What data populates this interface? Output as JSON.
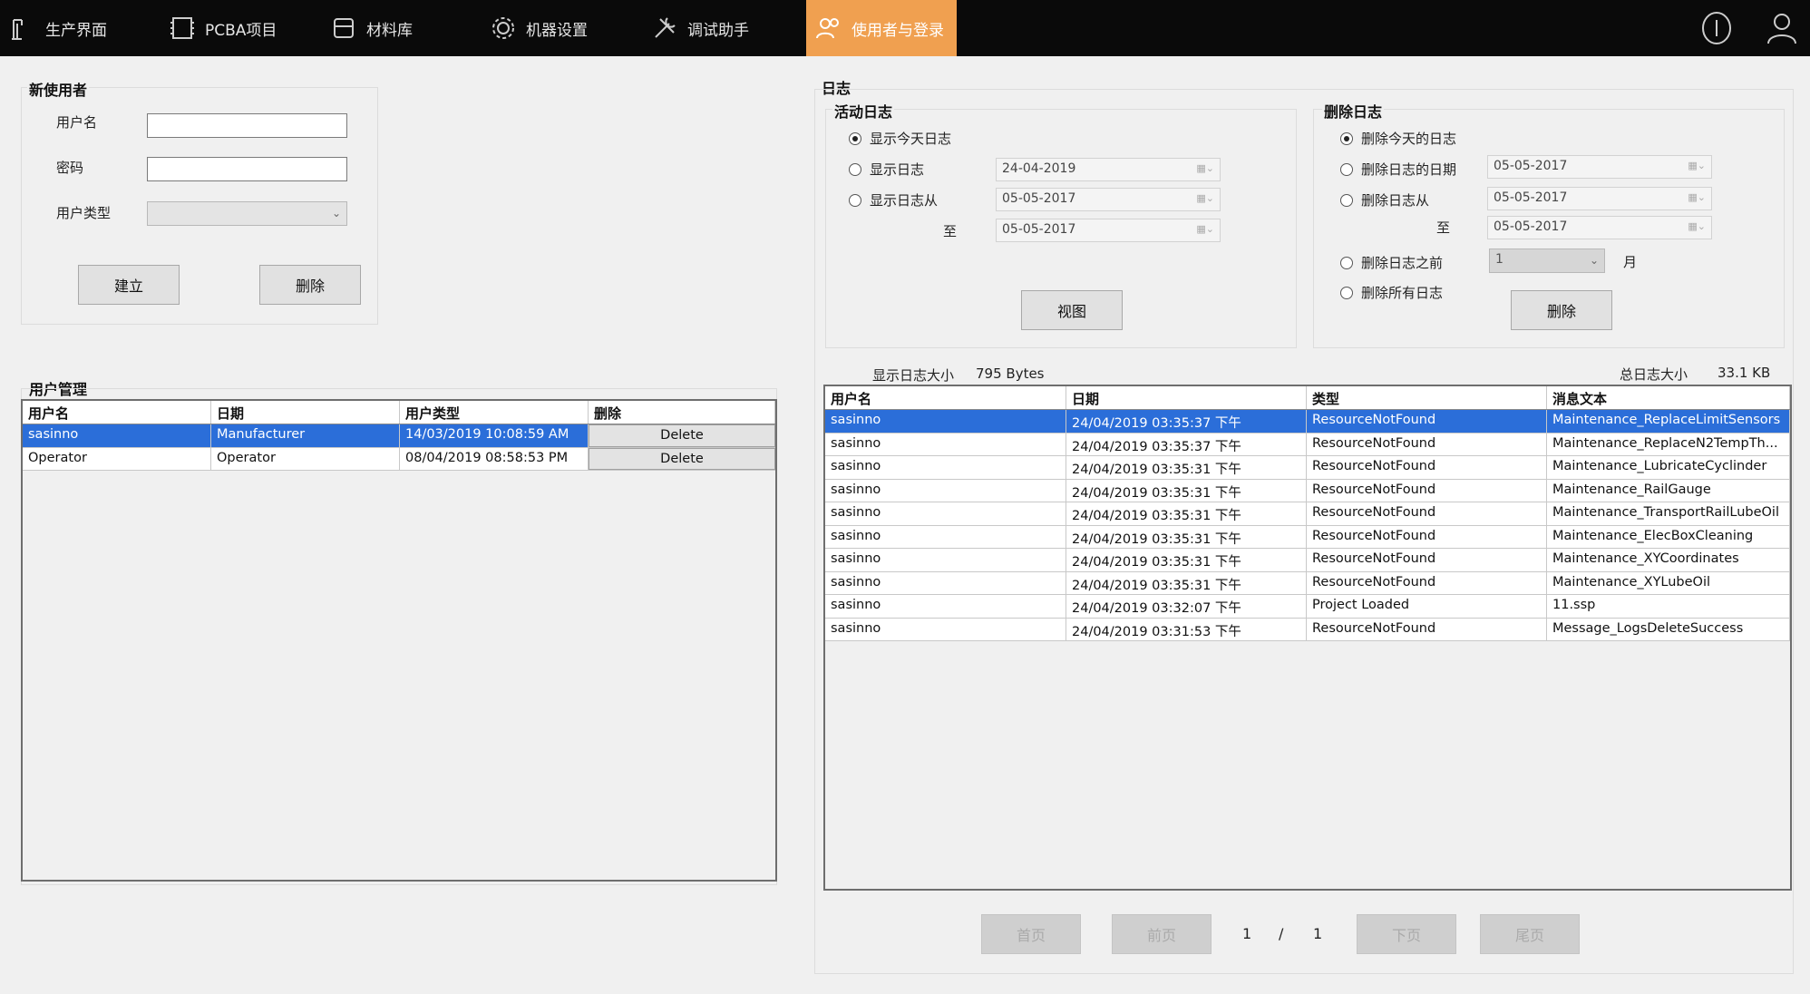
{
  "nav": {
    "items": [
      {
        "label": "生产界面",
        "icon": "production-icon"
      },
      {
        "label": "PCBA项目",
        "icon": "pcba-icon"
      },
      {
        "label": "材料库",
        "icon": "materials-icon"
      },
      {
        "label": "机器设置",
        "icon": "gear-icon"
      },
      {
        "label": "调试助手",
        "icon": "tools-icon"
      },
      {
        "label": "使用者与登录",
        "icon": "users-icon"
      }
    ],
    "active_index": 5,
    "accent_color": "#f0a050"
  },
  "new_user": {
    "title": "新使用者",
    "username_label": "用户名",
    "password_label": "密码",
    "user_type_label": "用户类型",
    "create_button": "建立",
    "delete_button": "删除"
  },
  "user_management": {
    "title": "用户管理",
    "columns": [
      "用户名",
      "日期",
      "用户类型",
      "删除"
    ],
    "rows": [
      {
        "username": "sasinno",
        "date": "Manufacturer",
        "type": "14/03/2019 10:08:59 AM",
        "action": "Delete",
        "selected": true
      },
      {
        "username": "Operator",
        "date": "Operator",
        "type": "08/04/2019 08:58:53 PM",
        "action": "Delete",
        "selected": false
      }
    ]
  },
  "log": {
    "title": "日志",
    "active_log": {
      "title": "活动日志",
      "options": [
        "显示今天日志",
        "显示日志",
        "显示日志从"
      ],
      "selected_index": 0,
      "date_single": "24-04-2019",
      "date_from": "05-05-2017",
      "to_label": "至",
      "date_to": "05-05-2017",
      "view_button": "视图"
    },
    "delete_log": {
      "title": "删除日志",
      "options": [
        "删除今天的日志",
        "删除日志的日期",
        "删除日志从",
        "删除日志之前",
        "删除所有日志"
      ],
      "selected_index": 0,
      "date_single": "05-05-2017",
      "date_from": "05-05-2017",
      "to_label": "至",
      "date_to": "05-05-2017",
      "months_value": "1",
      "months_unit": "月",
      "delete_button": "删除"
    },
    "shown_size_label": "显示日志大小",
    "shown_size_value": "795 Bytes",
    "total_size_label": "总日志大小",
    "total_size_value": "33.1 KB",
    "columns": [
      "用户名",
      "日期",
      "类型",
      "消息文本"
    ],
    "rows": [
      {
        "user": "sasinno",
        "date": "24/04/2019 03:35:37 下午",
        "type": "ResourceNotFound",
        "msg": "Maintenance_ReplaceLimitSensors",
        "selected": true
      },
      {
        "user": "sasinno",
        "date": "24/04/2019 03:35:37 下午",
        "type": "ResourceNotFound",
        "msg": "Maintenance_ReplaceN2TempTh...",
        "selected": false
      },
      {
        "user": "sasinno",
        "date": "24/04/2019 03:35:31 下午",
        "type": "ResourceNotFound",
        "msg": "Maintenance_LubricateCyclinder",
        "selected": false
      },
      {
        "user": "sasinno",
        "date": "24/04/2019 03:35:31 下午",
        "type": "ResourceNotFound",
        "msg": "Maintenance_RailGauge",
        "selected": false
      },
      {
        "user": "sasinno",
        "date": "24/04/2019 03:35:31 下午",
        "type": "ResourceNotFound",
        "msg": "Maintenance_TransportRailLubeOil",
        "selected": false
      },
      {
        "user": "sasinno",
        "date": "24/04/2019 03:35:31 下午",
        "type": "ResourceNotFound",
        "msg": "Maintenance_ElecBoxCleaning",
        "selected": false
      },
      {
        "user": "sasinno",
        "date": "24/04/2019 03:35:31 下午",
        "type": "ResourceNotFound",
        "msg": "Maintenance_XYCoordinates",
        "selected": false
      },
      {
        "user": "sasinno",
        "date": "24/04/2019 03:35:31 下午",
        "type": "ResourceNotFound",
        "msg": "Maintenance_XYLubeOil",
        "selected": false
      },
      {
        "user": "sasinno",
        "date": "24/04/2019 03:32:07 下午",
        "type": "Project Loaded",
        "msg": "11.ssp",
        "selected": false
      },
      {
        "user": "sasinno",
        "date": "24/04/2019 03:31:53 下午",
        "type": "ResourceNotFound",
        "msg": "Message_LogsDeleteSuccess",
        "selected": false
      }
    ],
    "pager": {
      "first": "首页",
      "prev": "前页",
      "current": "1",
      "separator": "/",
      "total": "1",
      "next": "下页",
      "last": "尾页"
    }
  }
}
